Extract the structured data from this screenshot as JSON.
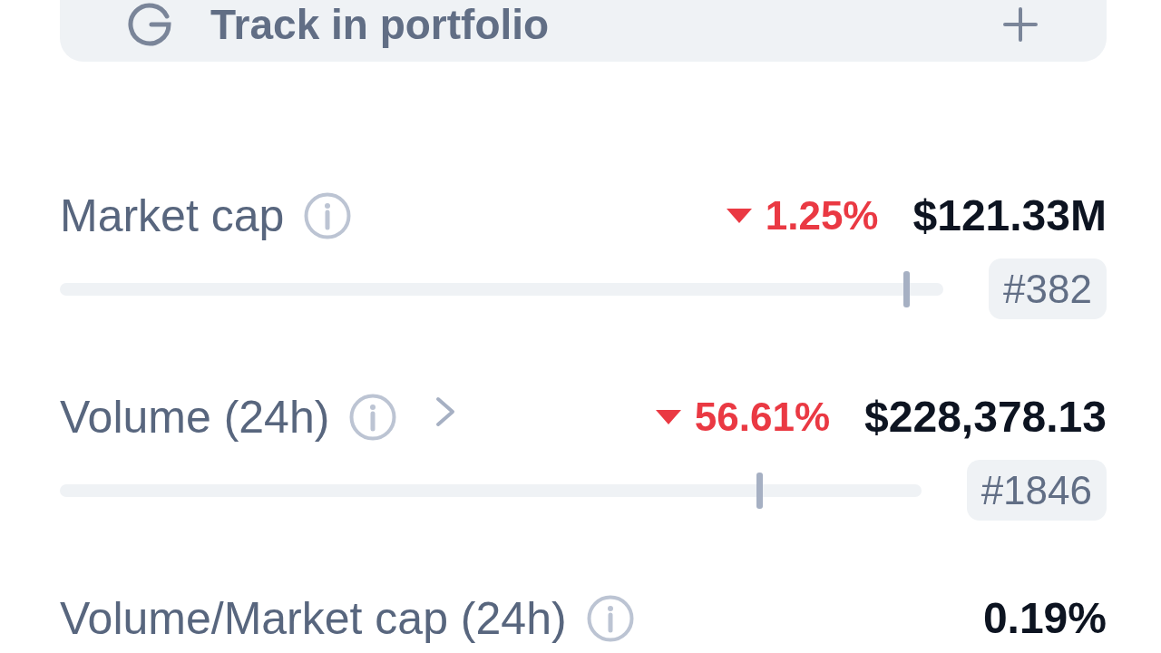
{
  "portfolio_button": {
    "label": "Track in portfolio"
  },
  "stats": [
    {
      "kind": "ranked",
      "label": "Market cap",
      "link": false,
      "change": {
        "decrease": true,
        "value": "1.25%"
      },
      "value": "$121.33M",
      "level": 0.958,
      "rank": "#382"
    },
    {
      "kind": "ranked",
      "label": "Volume (24h)",
      "link": true,
      "change": {
        "decrease": true,
        "value": "56.61%"
      },
      "value": "$228,378.13",
      "level": 0.812,
      "rank": "#1846"
    },
    {
      "kind": "plain",
      "label": "Volume/Market cap (24h)",
      "link": false,
      "value": "0.19%"
    }
  ]
}
